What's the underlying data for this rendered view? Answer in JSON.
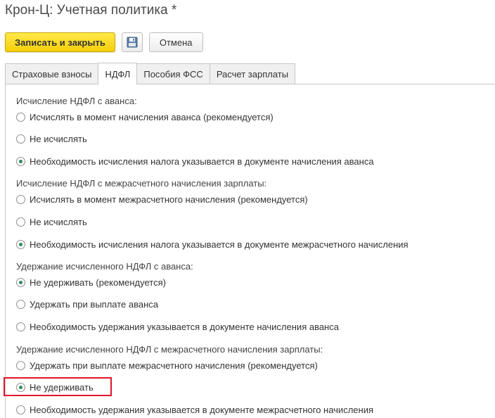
{
  "window": {
    "title": "Крон-Ц: Учетная политика *"
  },
  "toolbar": {
    "save_close_label": "Записать и закрыть",
    "save_icon": "floppy-disk-icon",
    "cancel_label": "Отмена"
  },
  "tabs": [
    {
      "label": "Страховые взносы",
      "active": false
    },
    {
      "label": "НДФЛ",
      "active": true
    },
    {
      "label": "Пособия ФСС",
      "active": false
    },
    {
      "label": "Расчет зарплаты",
      "active": false
    }
  ],
  "groups": [
    {
      "label": "Исчисление НДФЛ с аванса:",
      "options": [
        {
          "label": "Исчислять в момент начисления аванса (рекомендуется)",
          "checked": false
        },
        {
          "label": "Не исчислять",
          "checked": false
        },
        {
          "label": "Необходимость исчисления налога указывается в документе начисления аванса",
          "checked": true
        }
      ]
    },
    {
      "label": "Исчисление НДФЛ с межрасчетного начисления зарплаты:",
      "options": [
        {
          "label": "Исчислять в момент межрасчетного начисления (рекомендуется)",
          "checked": false
        },
        {
          "label": "Не исчислять",
          "checked": false
        },
        {
          "label": "Необходимость исчисления налога указывается в документе межрасчетного начисления",
          "checked": true
        }
      ]
    },
    {
      "label": "Удержание исчисленного НДФЛ с аванса:",
      "options": [
        {
          "label": "Не удерживать (рекомендуется)",
          "checked": true
        },
        {
          "label": "Удержать при выплате аванса",
          "checked": false
        },
        {
          "label": "Необходимость удержания указывается в документе начисления аванса",
          "checked": false
        }
      ]
    },
    {
      "label": "Удержание исчисленного НДФЛ с межрасчетного начисления зарплаты:",
      "options": [
        {
          "label": "Удержать при выплате межрасчетного начисления (рекомендуется)",
          "checked": false
        },
        {
          "label": "Не удерживать",
          "checked": true
        },
        {
          "label": "Необходимость удержания указывается в документе межрасчетного начисления",
          "checked": false
        }
      ]
    }
  ],
  "colors": {
    "primary_button": "#f5cf08",
    "radio_checked": "#2e8b57",
    "highlight_border": "#e0162b"
  }
}
